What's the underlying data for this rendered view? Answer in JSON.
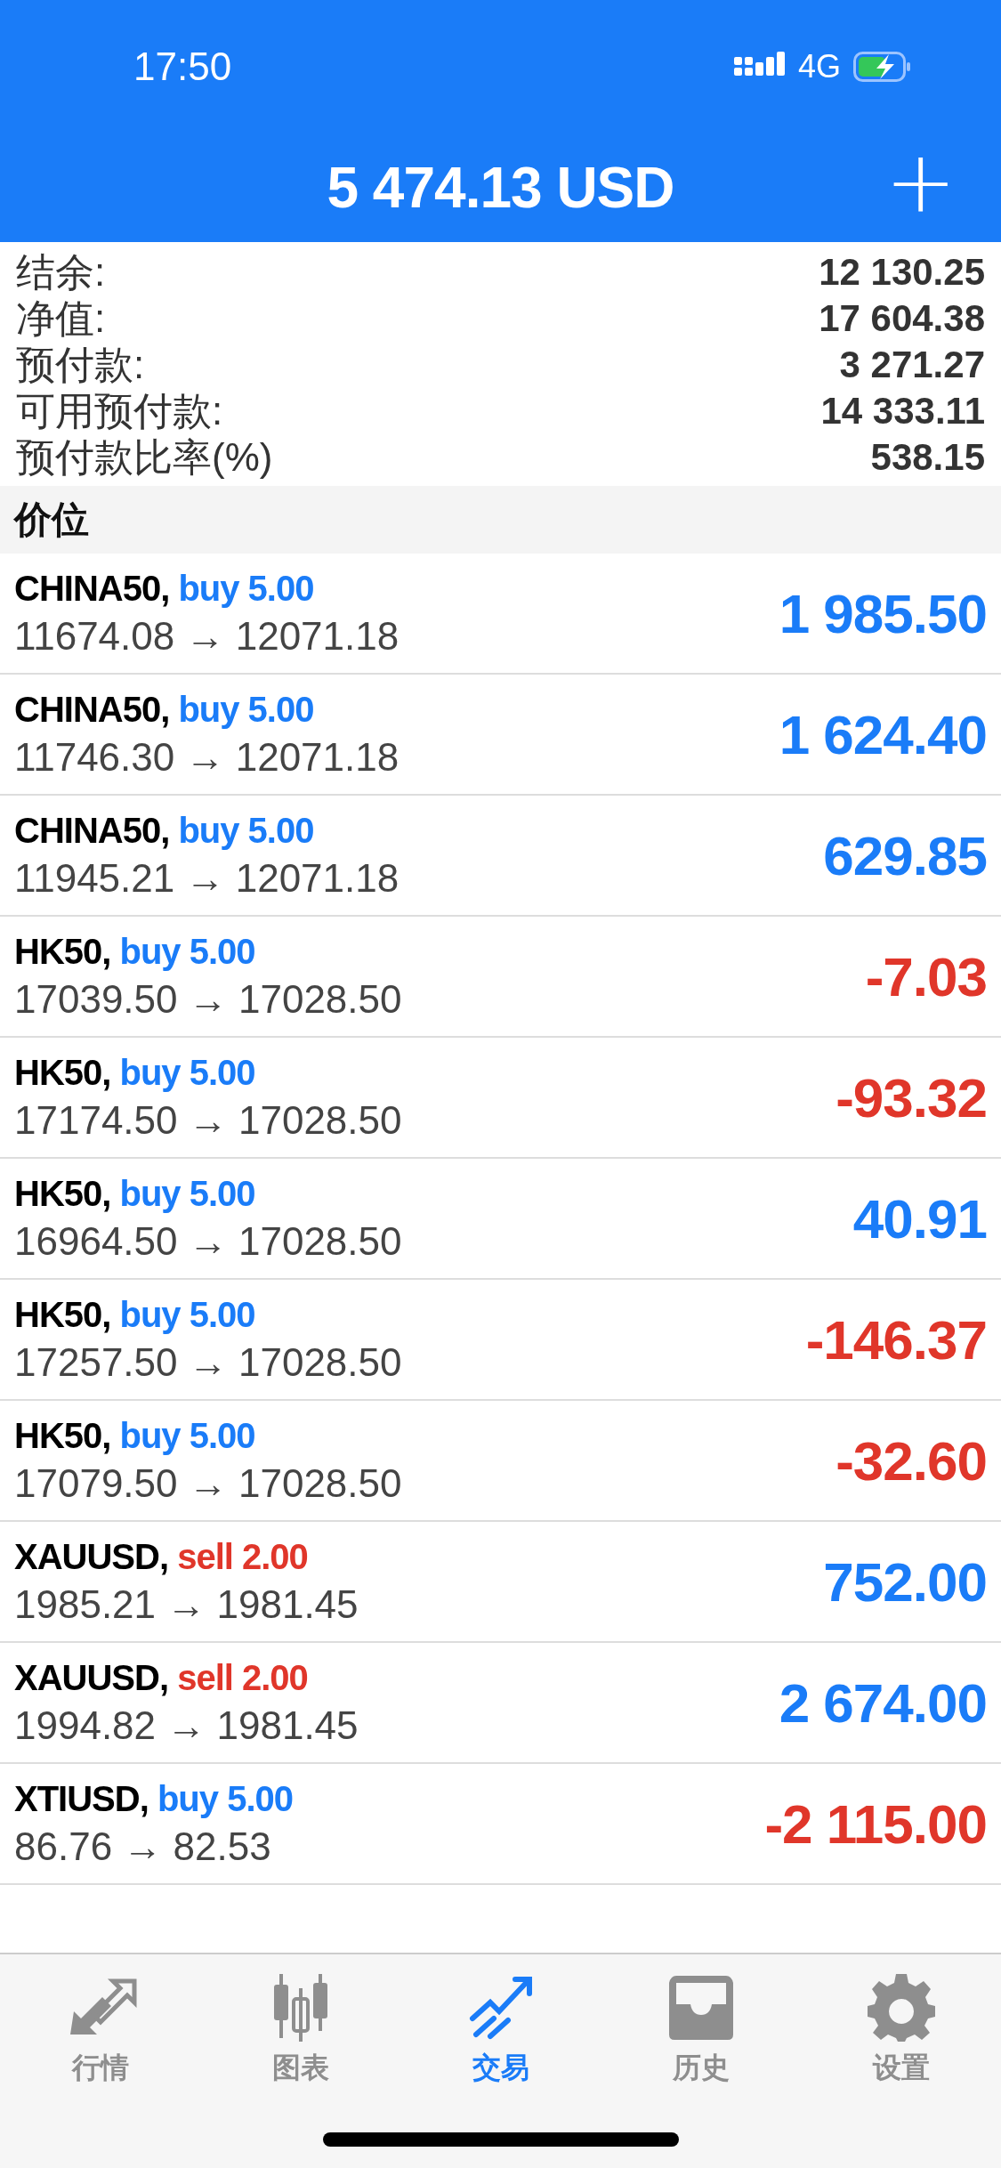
{
  "status_bar": {
    "time": "17:50",
    "network": "4G"
  },
  "header": {
    "title": "5 474.13 USD",
    "add_button": "+"
  },
  "summary": [
    {
      "label": "结余:",
      "value": "12 130.25"
    },
    {
      "label": "净值:",
      "value": "17 604.38"
    },
    {
      "label": "预付款:",
      "value": "3 271.27"
    },
    {
      "label": "可用预付款:",
      "value": "14 333.11"
    },
    {
      "label": "预付款比率(%)",
      "value": "538.15"
    }
  ],
  "section_title": "价位",
  "positions": [
    {
      "symbol": "CHINA50,",
      "kind": "buy",
      "side": "buy 5.00",
      "prices": "11674.08 → 12071.18",
      "profit": "1 985.50",
      "loss": false
    },
    {
      "symbol": "CHINA50,",
      "kind": "buy",
      "side": "buy 5.00",
      "prices": "11746.30 → 12071.18",
      "profit": "1 624.40",
      "loss": false
    },
    {
      "symbol": "CHINA50,",
      "kind": "buy",
      "side": "buy 5.00",
      "prices": "11945.21 → 12071.18",
      "profit": "629.85",
      "loss": false
    },
    {
      "symbol": "HK50,",
      "kind": "buy",
      "side": "buy 5.00",
      "prices": "17039.50 → 17028.50",
      "profit": "-7.03",
      "loss": true
    },
    {
      "symbol": "HK50,",
      "kind": "buy",
      "side": "buy 5.00",
      "prices": "17174.50 → 17028.50",
      "profit": "-93.32",
      "loss": true
    },
    {
      "symbol": "HK50,",
      "kind": "buy",
      "side": "buy 5.00",
      "prices": "16964.50 → 17028.50",
      "profit": "40.91",
      "loss": false
    },
    {
      "symbol": "HK50,",
      "kind": "buy",
      "side": "buy 5.00",
      "prices": "17257.50 → 17028.50",
      "profit": "-146.37",
      "loss": true
    },
    {
      "symbol": "HK50,",
      "kind": "buy",
      "side": "buy 5.00",
      "prices": "17079.50 → 17028.50",
      "profit": "-32.60",
      "loss": true
    },
    {
      "symbol": "XAUUSD,",
      "kind": "sell",
      "side": "sell 2.00",
      "prices": "1985.21 → 1981.45",
      "profit": "752.00",
      "loss": false
    },
    {
      "symbol": "XAUUSD,",
      "kind": "sell",
      "side": "sell 2.00",
      "prices": "1994.82 → 1981.45",
      "profit": "2 674.00",
      "loss": false
    },
    {
      "symbol": "XTIUSD,",
      "kind": "buy",
      "side": "buy 5.00",
      "prices": "86.76 → 82.53",
      "profit": "-2 115.00",
      "loss": true
    }
  ],
  "tab_bar": [
    {
      "label": "行情",
      "selected": false
    },
    {
      "label": "图表",
      "selected": false
    },
    {
      "label": "交易",
      "selected": true
    },
    {
      "label": "历史",
      "selected": false
    },
    {
      "label": "设置",
      "selected": false
    }
  ]
}
